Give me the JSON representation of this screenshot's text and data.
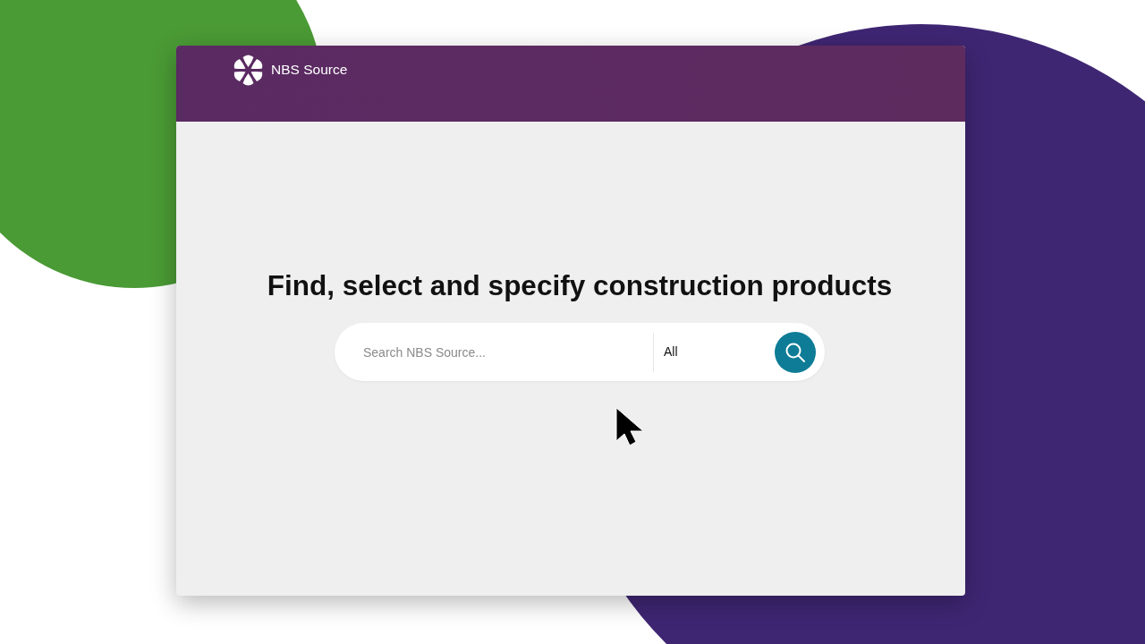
{
  "header": {
    "logo_text": "NBS Source"
  },
  "hero": {
    "heading": "Find, select and specify construction products"
  },
  "search": {
    "placeholder": "Search NBS Source...",
    "scope": "All"
  }
}
